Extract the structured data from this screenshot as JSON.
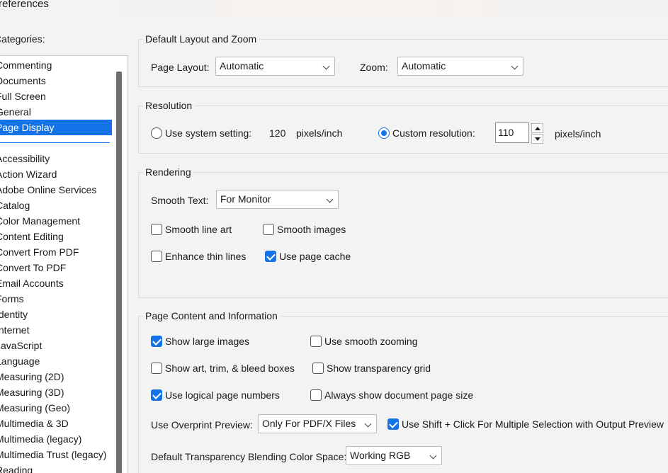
{
  "window": {
    "title": "Preferences"
  },
  "categories": {
    "label": "Categories:",
    "top_items": [
      "Commenting",
      "Documents",
      "Full Screen",
      "General",
      "Page Display"
    ],
    "selected": "Page Display",
    "items": [
      "Accessibility",
      "Action Wizard",
      "Adobe Online Services",
      "Catalog",
      "Color Management",
      "Content Editing",
      "Convert From PDF",
      "Convert To PDF",
      "Email Accounts",
      "Forms",
      "Identity",
      "Internet",
      "JavaScript",
      "Language",
      "Measuring (2D)",
      "Measuring (3D)",
      "Measuring (Geo)",
      "Multimedia & 3D",
      "Multimedia (legacy)",
      "Multimedia Trust (legacy)",
      "Reading"
    ]
  },
  "layout_zoom": {
    "title": "Default Layout and Zoom",
    "page_layout_label": "Page Layout:",
    "page_layout_value": "Automatic",
    "zoom_label": "Zoom:",
    "zoom_value": "Automatic"
  },
  "resolution": {
    "title": "Resolution",
    "system_label": "Use system setting:",
    "system_value": "120",
    "system_unit": "pixels/inch",
    "custom_label": "Custom resolution:",
    "custom_value": "110",
    "custom_unit": "pixels/inch",
    "selected": "custom"
  },
  "rendering": {
    "title": "Rendering",
    "smooth_text_label": "Smooth Text:",
    "smooth_text_value": "For Monitor",
    "smooth_line_art": "Smooth line art",
    "smooth_images": "Smooth images",
    "enhance_thin_lines": "Enhance thin lines",
    "use_page_cache": "Use page cache",
    "checked": {
      "smooth_line_art": false,
      "smooth_images": false,
      "enhance_thin_lines": false,
      "use_page_cache": true
    }
  },
  "page_content": {
    "title": "Page Content and Information",
    "show_large_images": "Show large images",
    "use_smooth_zooming": "Use smooth zooming",
    "show_art_trim": "Show art, trim, & bleed boxes",
    "show_transparency_grid": "Show transparency grid",
    "use_logical_page_numbers": "Use logical page numbers",
    "always_show_doc_size": "Always show document page size",
    "overprint_label": "Use Overprint Preview:",
    "overprint_value": "Only For PDF/X Files",
    "shift_click": "Use Shift + Click For Multiple Selection with Output Preview",
    "blending_label": "Default Transparency Blending Color Space:",
    "blending_value": "Working RGB",
    "checked": {
      "show_large_images": true,
      "use_smooth_zooming": false,
      "show_art_trim": false,
      "show_transparency_grid": false,
      "use_logical_page_numbers": true,
      "always_show_doc_size": false,
      "shift_click": true
    }
  },
  "colors": {
    "accent": "#1473e6",
    "background": "#f3f3f3"
  }
}
